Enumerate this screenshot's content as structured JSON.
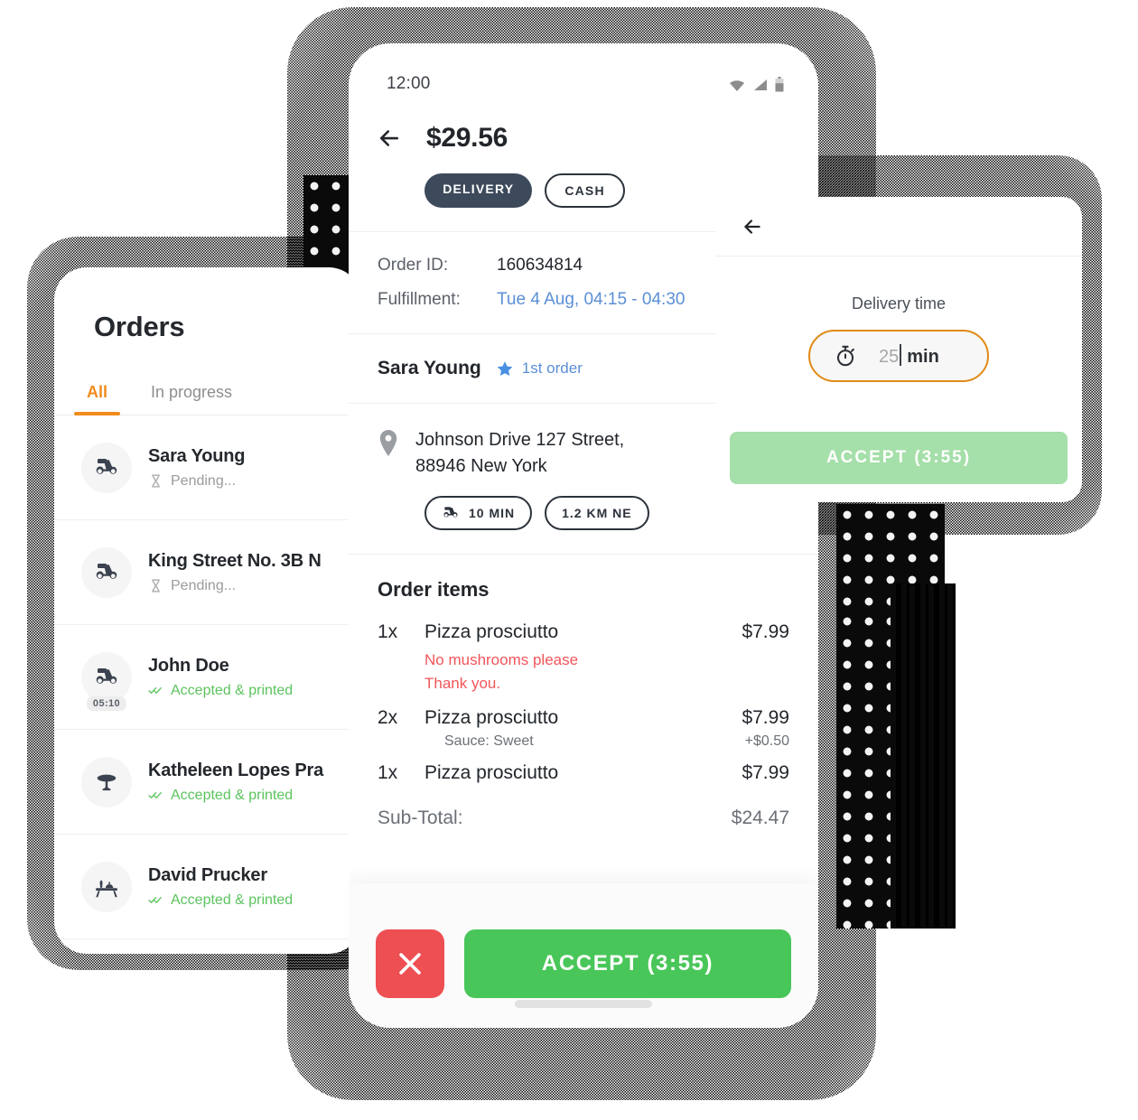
{
  "orders_panel": {
    "title": "Orders",
    "tabs": [
      {
        "label": "All",
        "active": true
      },
      {
        "label": "In progress",
        "active": false
      }
    ],
    "rows": [
      {
        "name": "Sara Young",
        "status": "Pending...",
        "state": "pending",
        "icon": "scooter-icon",
        "timer": ""
      },
      {
        "name": "King Street No. 3B N",
        "status": "Pending...",
        "state": "pending",
        "icon": "scooter-icon",
        "timer": ""
      },
      {
        "name": "John Doe",
        "status": "Accepted & printed",
        "state": "ok",
        "icon": "scooter-icon",
        "timer": "05:10"
      },
      {
        "name": "Katheleen Lopes Pra",
        "status": "Accepted & printed",
        "state": "ok",
        "icon": "round-table-icon",
        "timer": ""
      },
      {
        "name": "David Prucker",
        "status": "Accepted & printed",
        "state": "ok",
        "icon": "dine-in-table-icon",
        "timer": ""
      }
    ]
  },
  "phone": {
    "statusbar": {
      "clock": "12:00",
      "icons": [
        "wifi-icon",
        "signal-icon",
        "battery-icon"
      ]
    },
    "header": {
      "back_icon": "back-arrow-icon",
      "price": "$29.56",
      "chips": [
        {
          "label": "DELIVERY",
          "style": "solid"
        },
        {
          "label": "CASH",
          "style": "outline"
        }
      ]
    },
    "meta": [
      {
        "label": "Order ID:",
        "value": "160634814",
        "link": false
      },
      {
        "label": "Fulfillment:",
        "value": "Tue 4 Aug, 04:15 - 04:30",
        "link": true
      }
    ],
    "customer": {
      "name": "Sara Young",
      "badge_icon": "star-icon",
      "badge_text": "1st order"
    },
    "address": {
      "pin_icon": "map-pin-icon",
      "line1": "Johnson Drive 127 Street,",
      "line2": "88946 New York",
      "chips": [
        {
          "icon": "scooter-icon",
          "label": "10 MIN"
        },
        {
          "icon": "",
          "label": "1.2 KM NE"
        }
      ]
    },
    "order_items": {
      "title": "Order items",
      "items": [
        {
          "qty": "1x",
          "name": "Pizza prosciutto",
          "price": "$7.99",
          "note": "No mushrooms please\nThank you.",
          "option_name": "",
          "option_price": ""
        },
        {
          "qty": "2x",
          "name": "Pizza prosciutto",
          "price": "$7.99",
          "note": "",
          "option_name": "Sauce: Sweet",
          "option_price": "+$0.50"
        },
        {
          "qty": "1x",
          "name": "Pizza prosciutto",
          "price": "$7.99",
          "note": "",
          "option_name": "",
          "option_price": ""
        }
      ],
      "subtotal_label": "Sub-Total:",
      "subtotal_value": "$24.47"
    },
    "actions": {
      "reject_icon": "close-icon",
      "accept_label": "ACCEPT (3:55)"
    }
  },
  "popup": {
    "back_icon": "back-arrow-icon",
    "label": "Delivery time",
    "field": {
      "icon": "stopwatch-icon",
      "value": "25",
      "unit": "min"
    },
    "accept_label": "ACCEPT (3:55)"
  },
  "colors": {
    "accent_orange": "#f08b1d",
    "accept_green": "#49c659",
    "accept_green_muted": "#a5dfa9",
    "reject_red": "#ee4f53",
    "link_blue": "#5b8fd6",
    "note_red": "#f1555a",
    "dark_slate": "#3d4a5c",
    "status_ok_green": "#5cc35e"
  }
}
